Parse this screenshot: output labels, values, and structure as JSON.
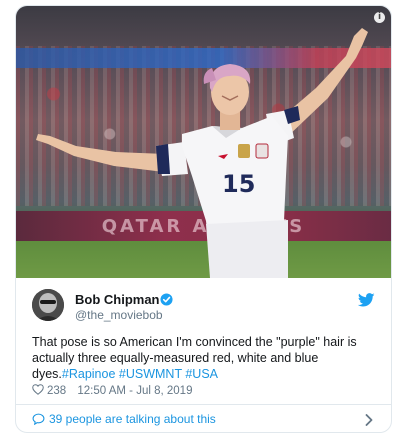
{
  "media": {
    "board_text": "QATAR AIRWAYS",
    "jersey_number": "15",
    "info_icon": "info-icon"
  },
  "author": {
    "name": "Bob Chipman",
    "handle": "@the_moviebob",
    "verified": true
  },
  "tweet": {
    "text": "That pose is so American I'm convinced the \"purple\" hair is actually three equally-measured red, white and blue dyes.",
    "hashtags": [
      "#Rapinoe",
      "#USWMNT",
      "#USA"
    ]
  },
  "meta": {
    "likes": "238",
    "timestamp": "12:50 AM - Jul 8, 2019"
  },
  "conversation": {
    "label": "39 people are talking about this"
  },
  "colors": {
    "link": "#1b95e0",
    "secondary": "#657786",
    "border": "#e1e8ed"
  },
  "icons": [
    "info-icon",
    "verified-badge-icon",
    "twitter-bird-icon",
    "heart-icon",
    "speech-bubble-icon",
    "chevron-right-icon"
  ]
}
